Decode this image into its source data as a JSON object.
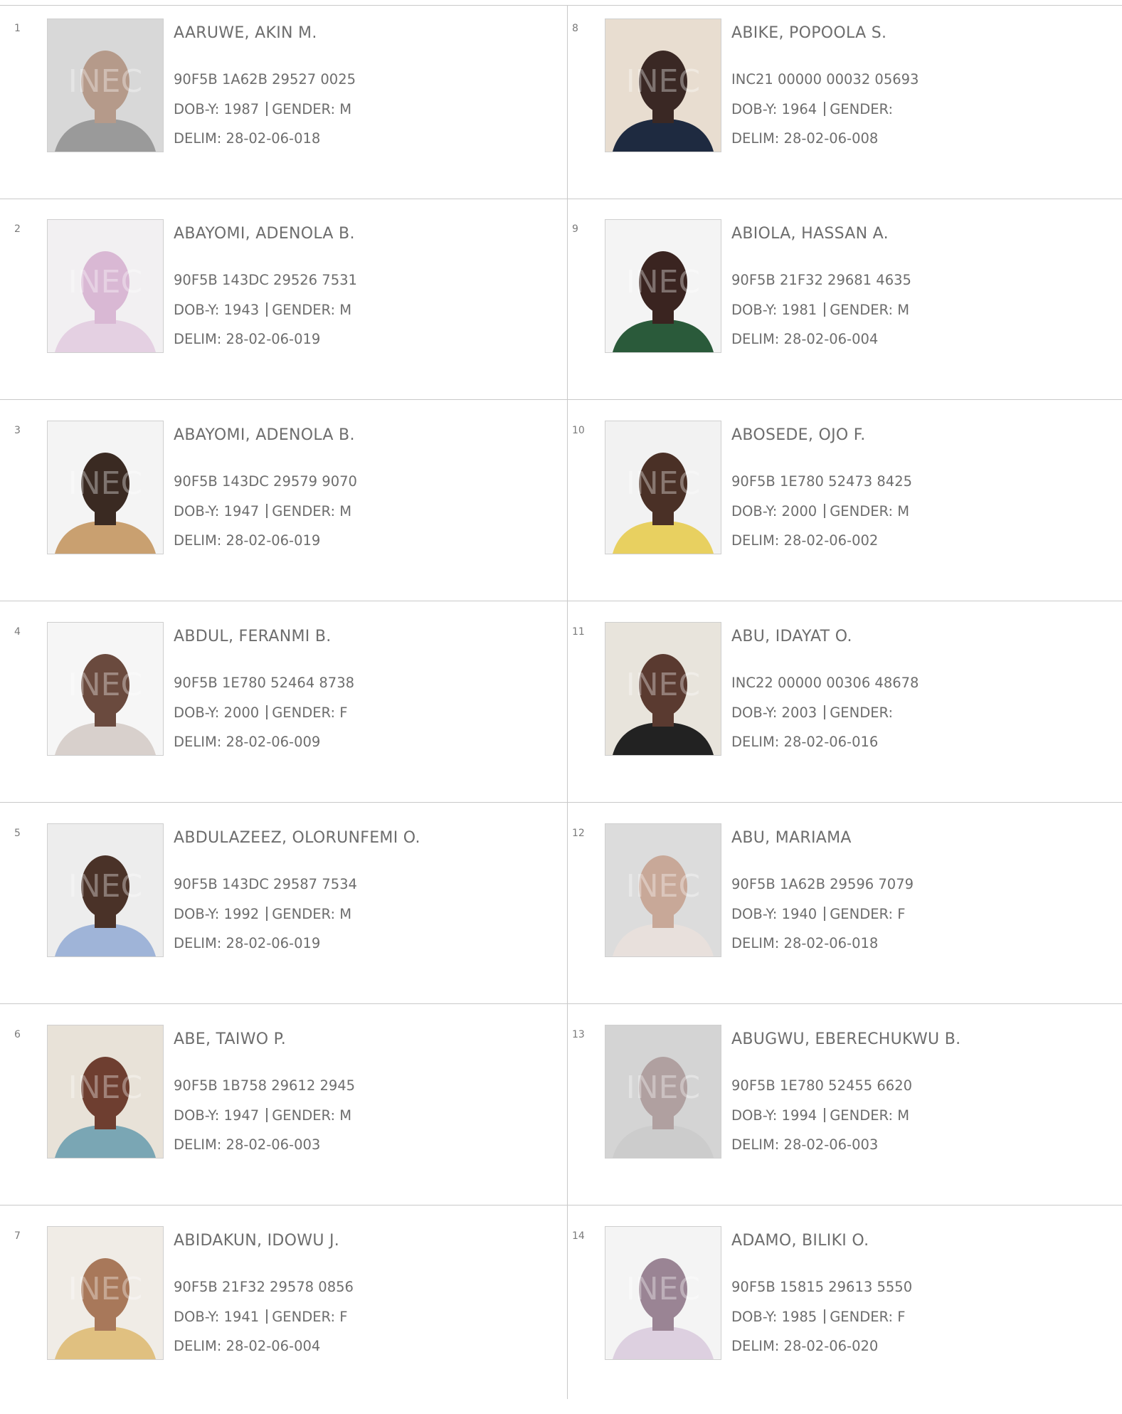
{
  "colors": {
    "text": "#6d6d6d",
    "rule": "#c9c9c9",
    "background": "#ffffff"
  },
  "photo_watermark": "INEC",
  "voters": [
    {
      "serial": "1",
      "name": "AARUWE, AKIN M.",
      "vin": "90F5B 1A62B 29527 0025",
      "dob": "DOB-Y: 1987",
      "gender": "GENDER: M",
      "delim": "DELIM: 28-02-06-018"
    },
    {
      "serial": "2",
      "name": "ABAYOMI, ADENOLA B.",
      "vin": "90F5B 143DC 29526 7531",
      "dob": "DOB-Y: 1943",
      "gender": "GENDER: M",
      "delim": "DELIM: 28-02-06-019"
    },
    {
      "serial": "3",
      "name": "ABAYOMI, ADENOLA B.",
      "vin": "90F5B 143DC 29579 9070",
      "dob": "DOB-Y: 1947",
      "gender": "GENDER: M",
      "delim": "DELIM: 28-02-06-019"
    },
    {
      "serial": "4",
      "name": "ABDUL, FERANMI B.",
      "vin": "90F5B 1E780 52464 8738",
      "dob": "DOB-Y: 2000",
      "gender": "GENDER: F",
      "delim": "DELIM: 28-02-06-009"
    },
    {
      "serial": "5",
      "name": "ABDULAZEEZ, OLORUNFEMI O.",
      "vin": "90F5B 143DC 29587 7534",
      "dob": "DOB-Y: 1992",
      "gender": "GENDER: M",
      "delim": "DELIM: 28-02-06-019"
    },
    {
      "serial": "6",
      "name": "ABE, TAIWO P.",
      "vin": "90F5B 1B758 29612 2945",
      "dob": "DOB-Y: 1947",
      "gender": "GENDER: M",
      "delim": "DELIM: 28-02-06-003"
    },
    {
      "serial": "7",
      "name": "ABIDAKUN, IDOWU J.",
      "vin": "90F5B 21F32 29578 0856",
      "dob": "DOB-Y: 1941",
      "gender": "GENDER: F",
      "delim": "DELIM: 28-02-06-004"
    },
    {
      "serial": "8",
      "name": "ABIKE, POPOOLA S.",
      "vin": "INC21 00000 00032 05693",
      "dob": "DOB-Y: 1964",
      "gender": "GENDER:",
      "delim": "DELIM: 28-02-06-008"
    },
    {
      "serial": "9",
      "name": "ABIOLA, HASSAN A.",
      "vin": "90F5B 21F32 29681 4635",
      "dob": "DOB-Y: 1981",
      "gender": "GENDER: M",
      "delim": "DELIM: 28-02-06-004"
    },
    {
      "serial": "10",
      "name": "ABOSEDE, OJO F.",
      "vin": "90F5B 1E780 52473 8425",
      "dob": "DOB-Y: 2000",
      "gender": "GENDER: M",
      "delim": "DELIM: 28-02-06-002"
    },
    {
      "serial": "11",
      "name": "ABU, IDAYAT O.",
      "vin": "INC22 00000 00306 48678",
      "dob": "DOB-Y: 2003",
      "gender": "GENDER:",
      "delim": "DELIM: 28-02-06-016"
    },
    {
      "serial": "12",
      "name": "ABU, MARIAMA",
      "vin": "90F5B 1A62B 29596 7079",
      "dob": "DOB-Y: 1940",
      "gender": "GENDER: F",
      "delim": "DELIM: 28-02-06-018"
    },
    {
      "serial": "13",
      "name": "ABUGWU, EBERECHUKWU B.",
      "vin": "90F5B 1E780 52455 6620",
      "dob": "DOB-Y: 1994",
      "gender": "GENDER: M",
      "delim": "DELIM: 28-02-06-003"
    },
    {
      "serial": "14",
      "name": "ADAMO, BILIKI O.",
      "vin": "90F5B 15815 29613 5550",
      "dob": "DOB-Y: 1985",
      "gender": "GENDER: F",
      "delim": "DELIM: 28-02-06-020"
    }
  ]
}
